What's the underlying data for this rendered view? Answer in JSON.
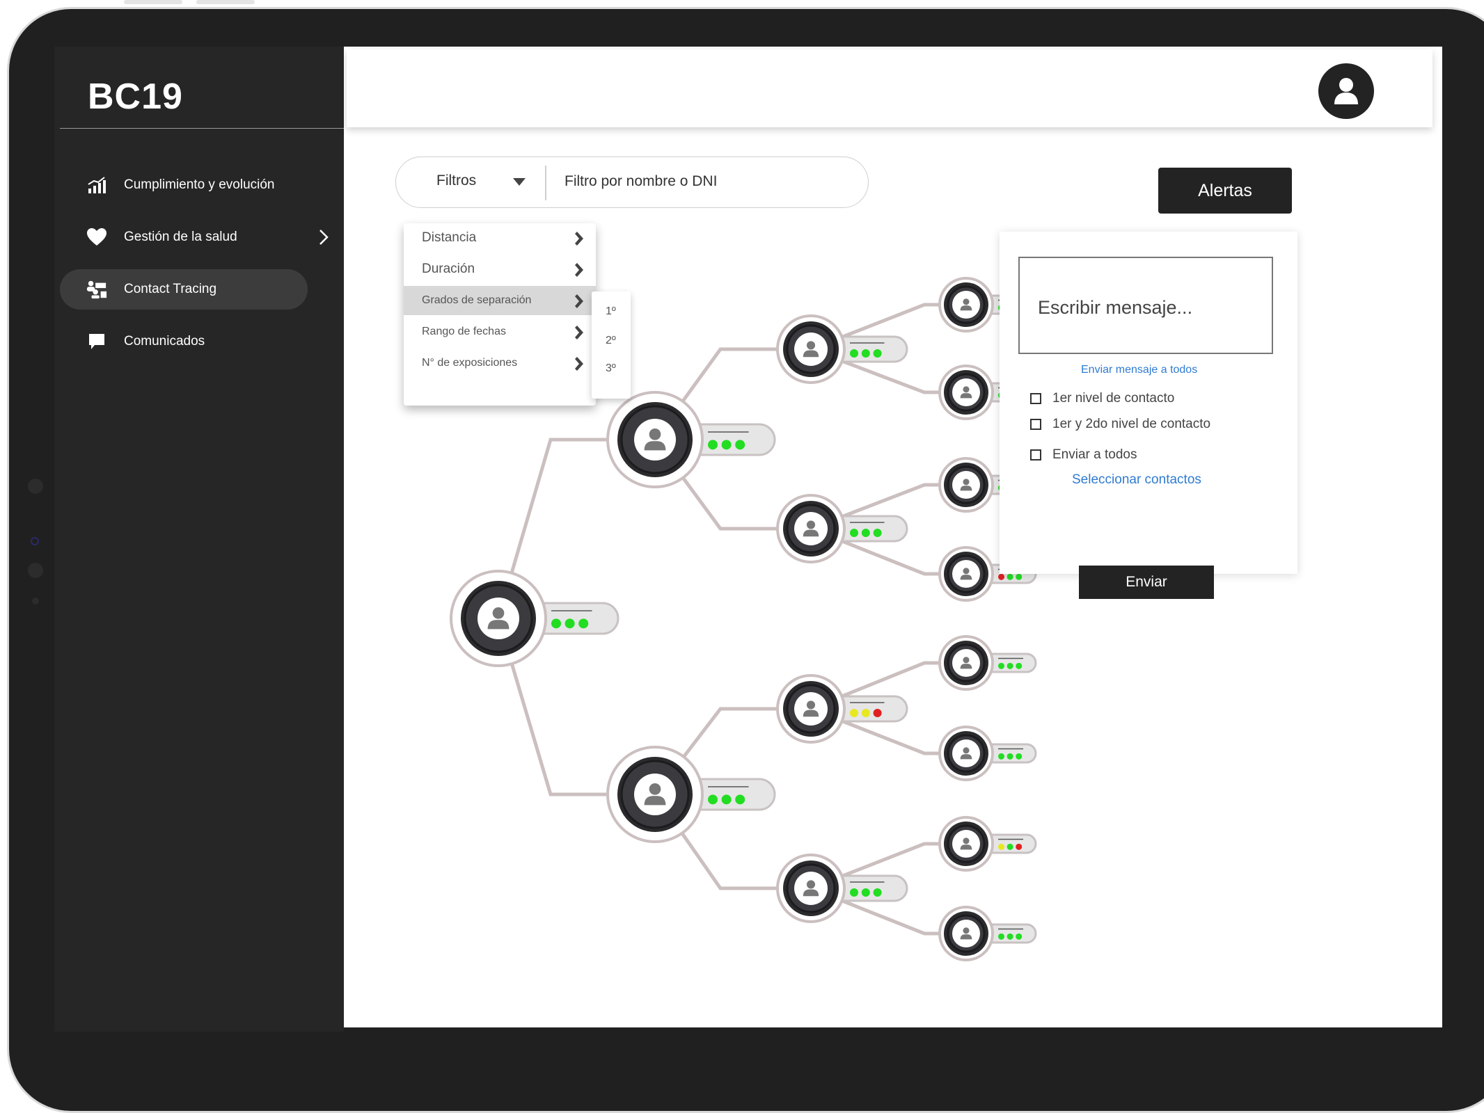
{
  "app": {
    "logo": "BC19"
  },
  "sidebar": {
    "items": [
      {
        "label": "Cumplimiento y evolución",
        "icon": "chart-icon"
      },
      {
        "label": "Gestión de la salud",
        "icon": "heart-icon"
      },
      {
        "label": "Contact Tracing",
        "icon": "people-icon"
      },
      {
        "label": "Comunicados",
        "icon": "chat-icon"
      }
    ],
    "active_index": 2
  },
  "header": {
    "avatar_icon": "user-avatar-icon"
  },
  "filters": {
    "button_label": "Filtros",
    "search_placeholder": "Filtro por nombre o DNI",
    "menu": [
      {
        "label": "Distancia"
      },
      {
        "label": "Duración"
      },
      {
        "label": "Grados de separación"
      },
      {
        "label": "Rango de fechas"
      },
      {
        "label": "N° de exposiciones"
      }
    ],
    "active_index": 2,
    "submenu": [
      "1º",
      "2º",
      "3º"
    ]
  },
  "alerts": {
    "button_label": "Alertas",
    "message_placeholder": "Escribir mensaje...",
    "send_all_link": "Enviar mensaje a todos",
    "options": [
      {
        "label": "1er nivel de contacto"
      },
      {
        "label": "1er y 2do nivel de contacto"
      },
      {
        "label": "Enviar a todos"
      }
    ],
    "select_contacts_link": "Seleccionar contactos",
    "send_button": "Enviar"
  },
  "tree": {
    "status_colors": {
      "ok": "#22dd22",
      "warning": "#e8e820",
      "alert": "#e02020"
    },
    "nodes": [
      {
        "id": "root",
        "status": [
          "ok",
          "ok",
          "ok"
        ]
      },
      {
        "id": "l1a",
        "status": [
          "ok",
          "ok",
          "ok"
        ]
      },
      {
        "id": "l1b",
        "status": [
          "ok",
          "ok",
          "ok"
        ]
      },
      {
        "id": "l2a",
        "status": [
          "ok",
          "ok",
          "ok"
        ]
      },
      {
        "id": "l2b",
        "status": [
          "ok",
          "ok",
          "ok"
        ]
      },
      {
        "id": "l2c",
        "status": [
          "warning",
          "warning",
          "alert"
        ]
      },
      {
        "id": "l2d",
        "status": [
          "ok",
          "ok",
          "ok"
        ]
      },
      {
        "id": "l3a",
        "status": [
          "ok",
          "ok",
          "ok"
        ]
      },
      {
        "id": "l3b",
        "status": [
          "ok",
          "ok",
          "ok"
        ]
      },
      {
        "id": "l3c",
        "status": [
          "ok",
          "ok",
          "ok"
        ]
      },
      {
        "id": "l3d",
        "status": [
          "alert",
          "ok",
          "ok"
        ]
      },
      {
        "id": "l3e",
        "status": [
          "ok",
          "ok",
          "ok"
        ]
      },
      {
        "id": "l3f",
        "status": [
          "ok",
          "ok",
          "ok"
        ]
      },
      {
        "id": "l3g",
        "status": [
          "warning",
          "ok",
          "alert"
        ]
      },
      {
        "id": "l3h",
        "status": [
          "ok",
          "ok",
          "ok"
        ]
      }
    ]
  }
}
